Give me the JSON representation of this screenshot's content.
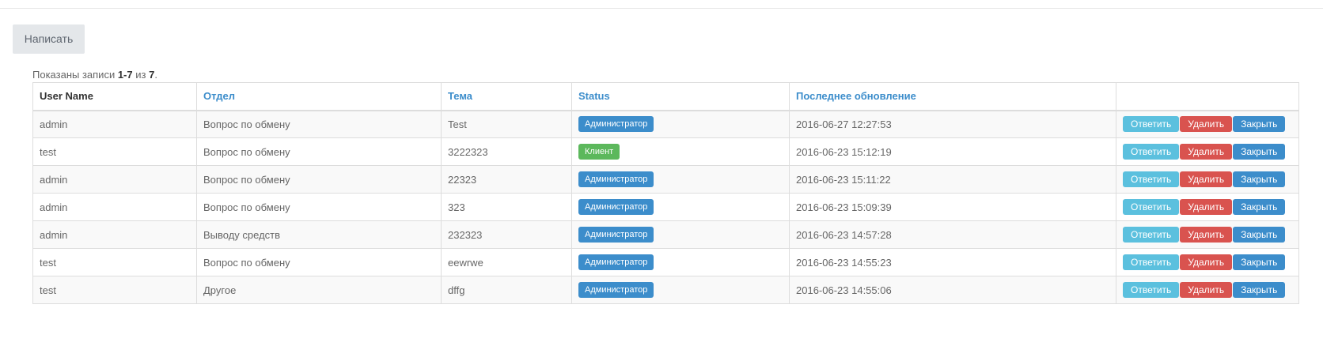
{
  "toolbar": {
    "compose_label": "Написать"
  },
  "summary": {
    "prefix": "Показаны записи ",
    "range": "1-7",
    "middle": " из ",
    "total": "7",
    "suffix": "."
  },
  "table": {
    "headers": [
      "User Name",
      "Отдел",
      "Тема",
      "Status",
      "Последнее обновление",
      ""
    ],
    "actions": {
      "reply": "Ответить",
      "delete": "Удалить",
      "close": "Закрыть"
    },
    "rows": [
      {
        "user": "admin",
        "dept": "Вопрос по обмену",
        "subject": "Test",
        "status": "Администратор",
        "status_type": "admin",
        "updated": "2016-06-27 12:27:53"
      },
      {
        "user": "test",
        "dept": "Вопрос по обмену",
        "subject": "3222323",
        "status": "Клиент",
        "status_type": "client",
        "updated": "2016-06-23 15:12:19"
      },
      {
        "user": "admin",
        "dept": "Вопрос по обмену",
        "subject": "22323",
        "status": "Администратор",
        "status_type": "admin",
        "updated": "2016-06-23 15:11:22"
      },
      {
        "user": "admin",
        "dept": "Вопрос по обмену",
        "subject": "323",
        "status": "Администратор",
        "status_type": "admin",
        "updated": "2016-06-23 15:09:39"
      },
      {
        "user": "admin",
        "dept": "Выводу средств",
        "subject": "232323",
        "status": "Администратор",
        "status_type": "admin",
        "updated": "2016-06-23 14:57:28"
      },
      {
        "user": "test",
        "dept": "Вопрос по обмену",
        "subject": "eewrwe",
        "status": "Администратор",
        "status_type": "admin",
        "updated": "2016-06-23 14:55:23"
      },
      {
        "user": "test",
        "dept": "Другое",
        "subject": "dffg",
        "status": "Администратор",
        "status_type": "admin",
        "updated": "2016-06-23 14:55:06"
      }
    ]
  },
  "colors": {
    "link": "#3c8dcb",
    "admin_badge": "#3c8dcb",
    "client_badge": "#5cb85c",
    "reply_button": "#5bc0de",
    "delete_button": "#d9534f",
    "close_button": "#3c8dcb"
  }
}
